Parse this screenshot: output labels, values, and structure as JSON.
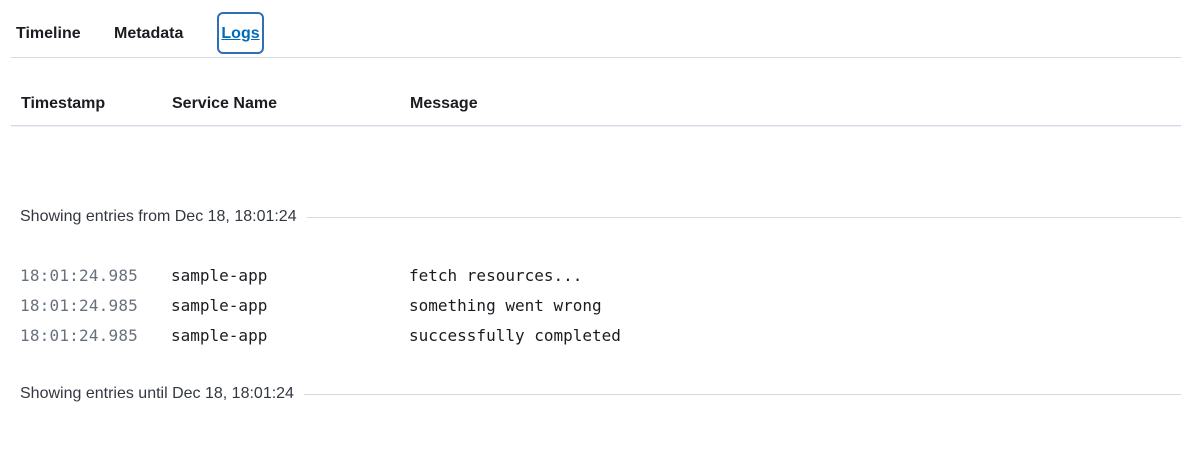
{
  "tabs": [
    {
      "label": "Timeline",
      "active": false
    },
    {
      "label": "Metadata",
      "active": false
    },
    {
      "label": "Logs",
      "active": true
    }
  ],
  "table": {
    "columns": [
      "Timestamp",
      "Service Name",
      "Message"
    ]
  },
  "dividers": {
    "start": "Showing entries from Dec 18, 18:01:24",
    "end": "Showing entries until Dec 18, 18:01:24"
  },
  "logs": [
    {
      "timestamp": "18:01:24.985",
      "service": "sample-app",
      "message": "fetch resources..."
    },
    {
      "timestamp": "18:01:24.985",
      "service": "sample-app",
      "message": "something went wrong"
    },
    {
      "timestamp": "18:01:24.985",
      "service": "sample-app",
      "message": "successfully completed"
    }
  ],
  "colors": {
    "active_tab": "#006bb8",
    "focus_ring": "#2f6fb8",
    "timestamp_text": "#69707d",
    "divider": "#d3dae6"
  }
}
